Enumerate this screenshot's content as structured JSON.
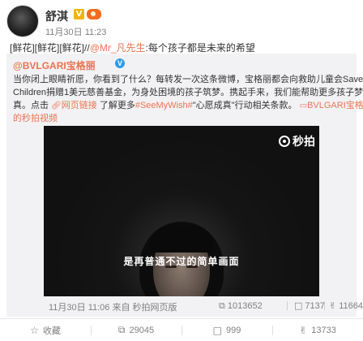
{
  "post": {
    "username": "舒淇",
    "verified_badge": "V",
    "time": "11月30日 11:23",
    "text_prefix": "[鲜花][鲜花][鲜花]//",
    "text_mention": "@Mr_凡先生",
    "text_suffix": ":每个孩子都是未来的希望"
  },
  "repost": {
    "author": "@BVLGARI宝格丽",
    "verified_badge": "V",
    "lines": [
      "当你闭上眼睛祈愿，你看到了什么？每转发一次这条微博，宝格丽都会向救助儿童会Save the",
      "Children捐赠1美元慈善基金，为身处困境的孩子筑梦。携起手来，我们能帮助更多孩子梦想成"
    ],
    "line3_prefix": "真。点击",
    "link_icon": "link-icon",
    "link_text": "网页链接",
    "line3_middle": "了解更多",
    "hashtag": "#SeeMyWish#",
    "line3_suffix": "\"心愿成真\"行动相关条款。",
    "video_icon": "video-icon",
    "video_link_part1": "BVLGARI宝格丽",
    "video_link_part2": "的秒拍视频",
    "video": {
      "watermark": "秒拍",
      "subtitle": "是再普通不过的简单画面"
    },
    "footer": {
      "time_source": "11月30日 11:06 来自 秒拍网页版",
      "repost_icon": "repost-icon",
      "repost_count": "1013652",
      "comment_icon": "comment-icon",
      "comment_count": "7137",
      "like_icon": "thumbs-up-icon",
      "like_count": "11664"
    }
  },
  "actions": [
    {
      "icon": "star-icon",
      "label": "收藏"
    },
    {
      "icon": "repost-icon",
      "label": "29045"
    },
    {
      "icon": "comment-icon",
      "label": "999"
    },
    {
      "icon": "thumbs-up-icon",
      "label": "13733"
    }
  ],
  "colors": {
    "accent": "#eb7350",
    "muted": "#808080",
    "repost_bg": "#f2f2f5"
  }
}
